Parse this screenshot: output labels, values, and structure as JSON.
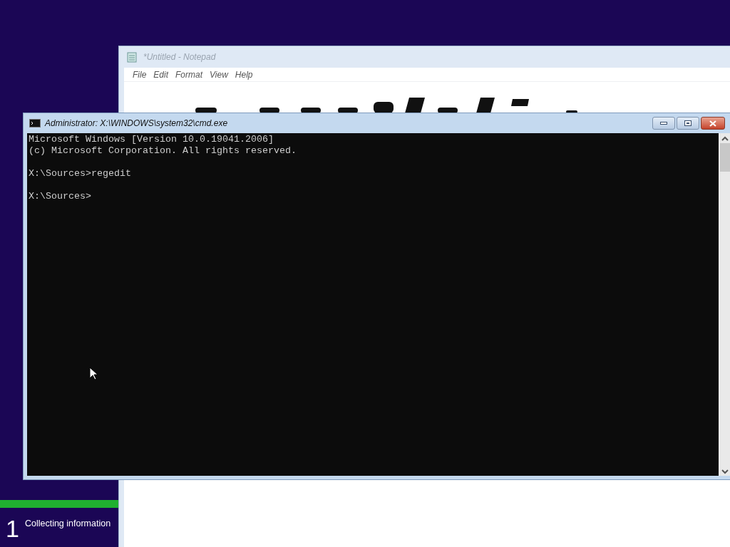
{
  "notepad": {
    "title": "*Untitled - Notepad",
    "menu": [
      "File",
      "Edit",
      "Format",
      "View",
      "Help"
    ]
  },
  "console": {
    "title": "Administrator: X:\\WINDOWS\\system32\\cmd.exe",
    "blocks": [
      [
        "Microsoft Windows [Version 10.0.19041.2006]",
        "(c) Microsoft Corporation. All rights reserved."
      ],
      [
        "X:\\Sources>regedit"
      ],
      [
        "X:\\Sources>"
      ]
    ]
  },
  "setup_progress": {
    "level": 1,
    "step": "1",
    "label": "Collecting information"
  }
}
